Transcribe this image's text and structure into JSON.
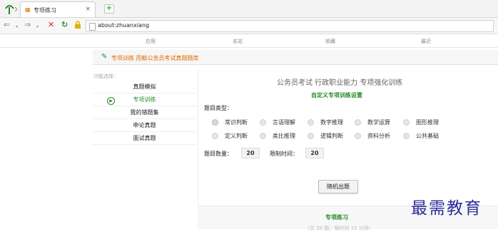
{
  "browser": {
    "tab_title": "专项练习",
    "tab_close": "×",
    "new_tab": "+",
    "url": "about:zhuanxiang"
  },
  "site_nav": [
    "应用",
    "名站",
    "收藏",
    "最近"
  ],
  "page": {
    "title": "专项训练 而鲸公务员考试真题题库"
  },
  "sidebar": {
    "label": "功能选择：",
    "items": [
      "真题模拟",
      "专项训练",
      "我的错题集",
      "申论真题",
      "面试真题"
    ],
    "active_index": 1
  },
  "main": {
    "heading": "公务员考试 行政职业能力 专项强化训练",
    "custom_title": "自定义专项训练设置",
    "type_label": "题目类型：",
    "types_row1": [
      "常识判断",
      "言语理解",
      "数字推理",
      "数学运算",
      "图形推理"
    ],
    "types_row2": [
      "定义判断",
      "类比推理",
      "逻辑判断",
      "资料分析",
      "公共基础"
    ],
    "selected_type": "常识判断",
    "count_label": "题目数量：",
    "count_value": "20",
    "time_label": "限制时间：",
    "time_value": "20",
    "generate_button": "随机出题"
  },
  "bottom": {
    "title": "专项练习",
    "subtitle": "（共 20 题，限时间 15 分钟）"
  },
  "watermark": "最需教育"
}
